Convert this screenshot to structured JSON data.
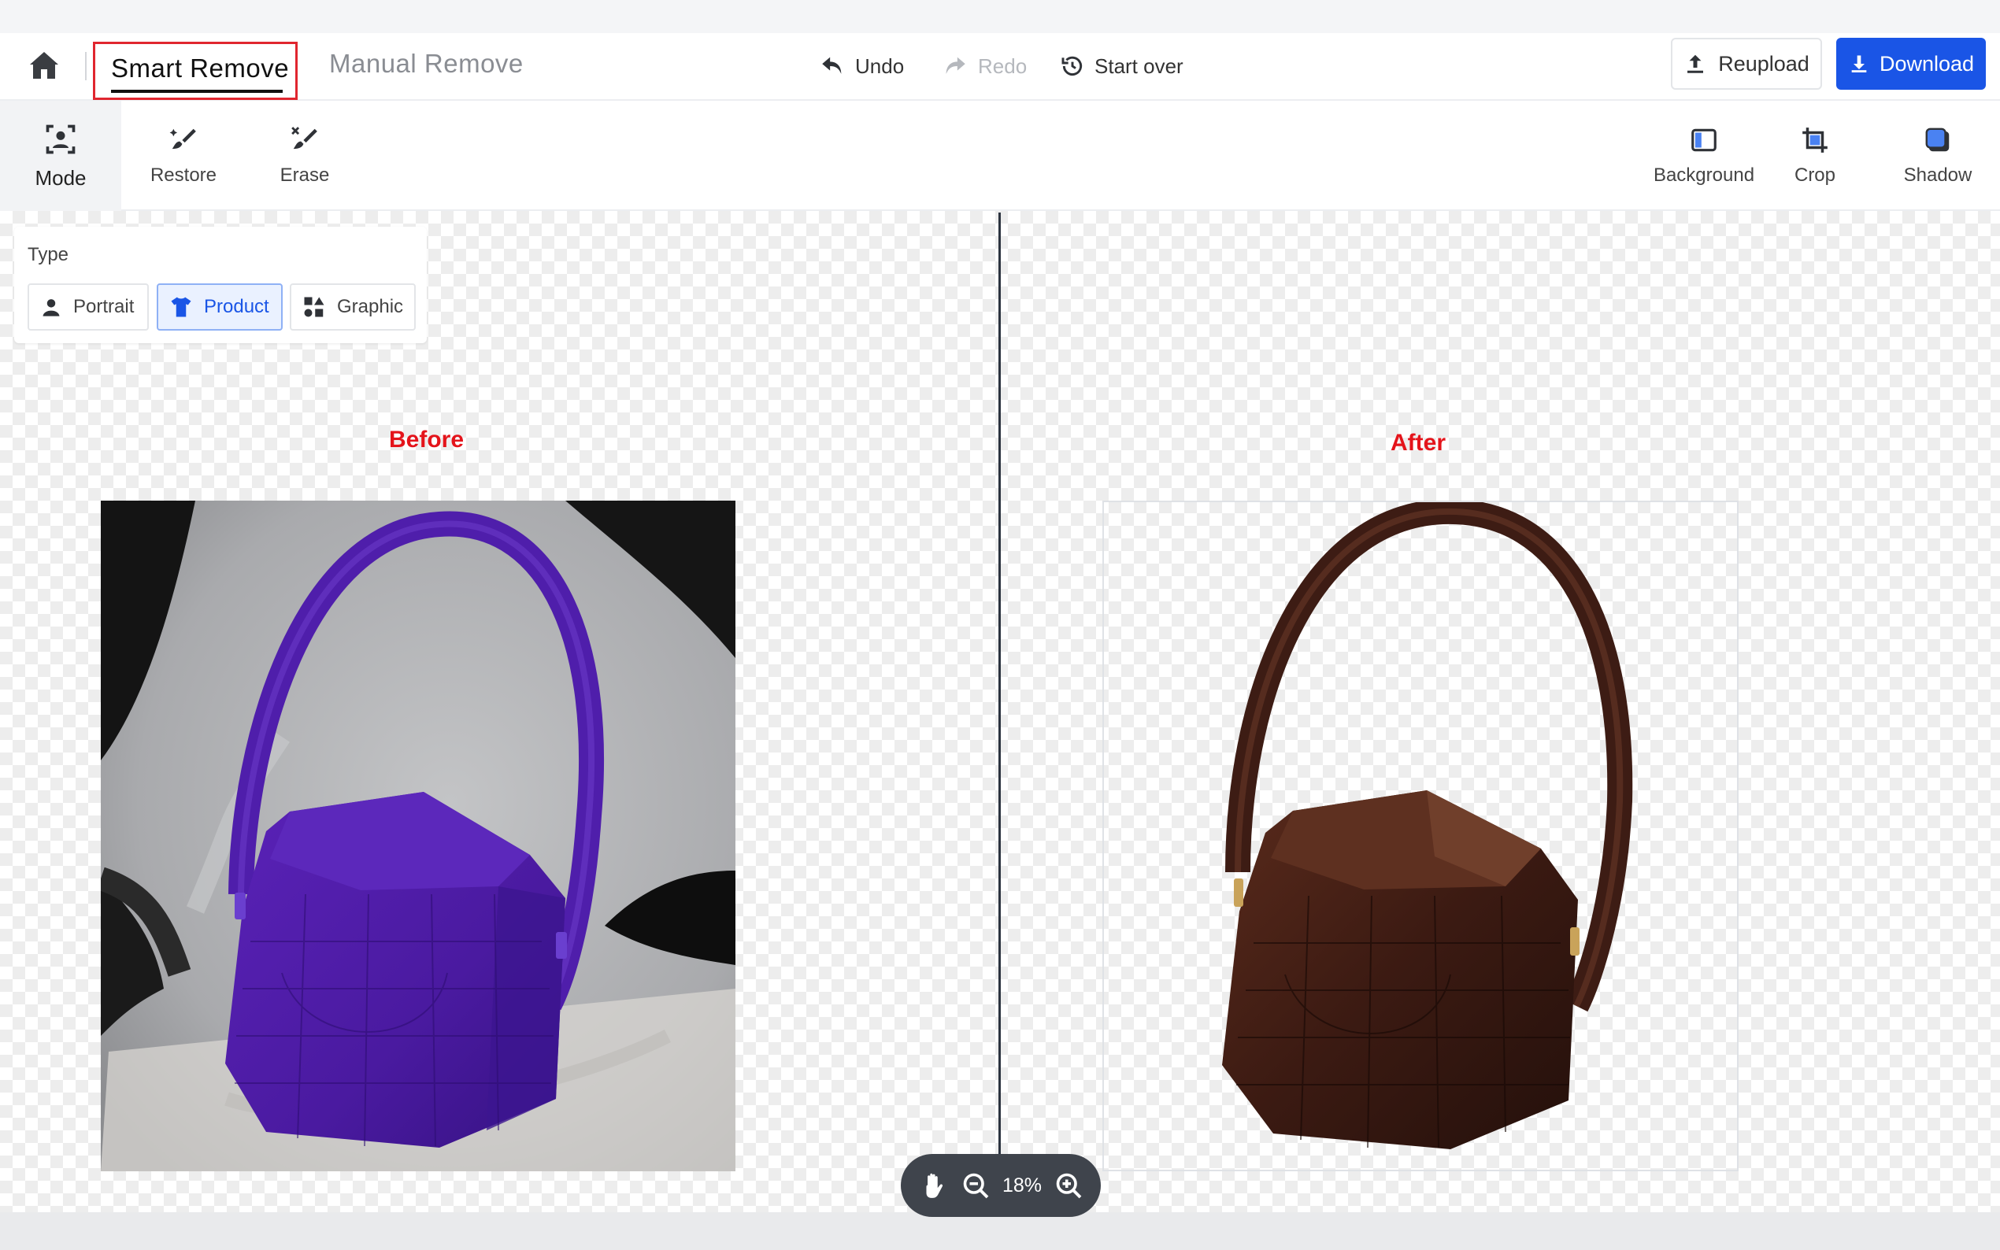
{
  "header": {
    "tabs": {
      "smart": "Smart Remove",
      "manual": "Manual Remove"
    },
    "undo": "Undo",
    "redo": "Redo",
    "start_over": "Start over",
    "reupload": "Reupload",
    "download": "Download"
  },
  "toolbar": {
    "mode": "Mode",
    "restore": "Restore",
    "erase": "Erase",
    "background": "Background",
    "crop": "Crop",
    "shadow": "Shadow"
  },
  "type_panel": {
    "label": "Type",
    "options": [
      "Portrait",
      "Product",
      "Graphic"
    ],
    "selected": "Product"
  },
  "canvas": {
    "before_label": "Before",
    "after_label": "After"
  },
  "zoom": {
    "value": "18%"
  },
  "colors": {
    "accent": "#1a55e6",
    "highlight_red": "#e4141b",
    "before_bag": "#4a1aa0",
    "after_bag": "#3b1a12"
  }
}
